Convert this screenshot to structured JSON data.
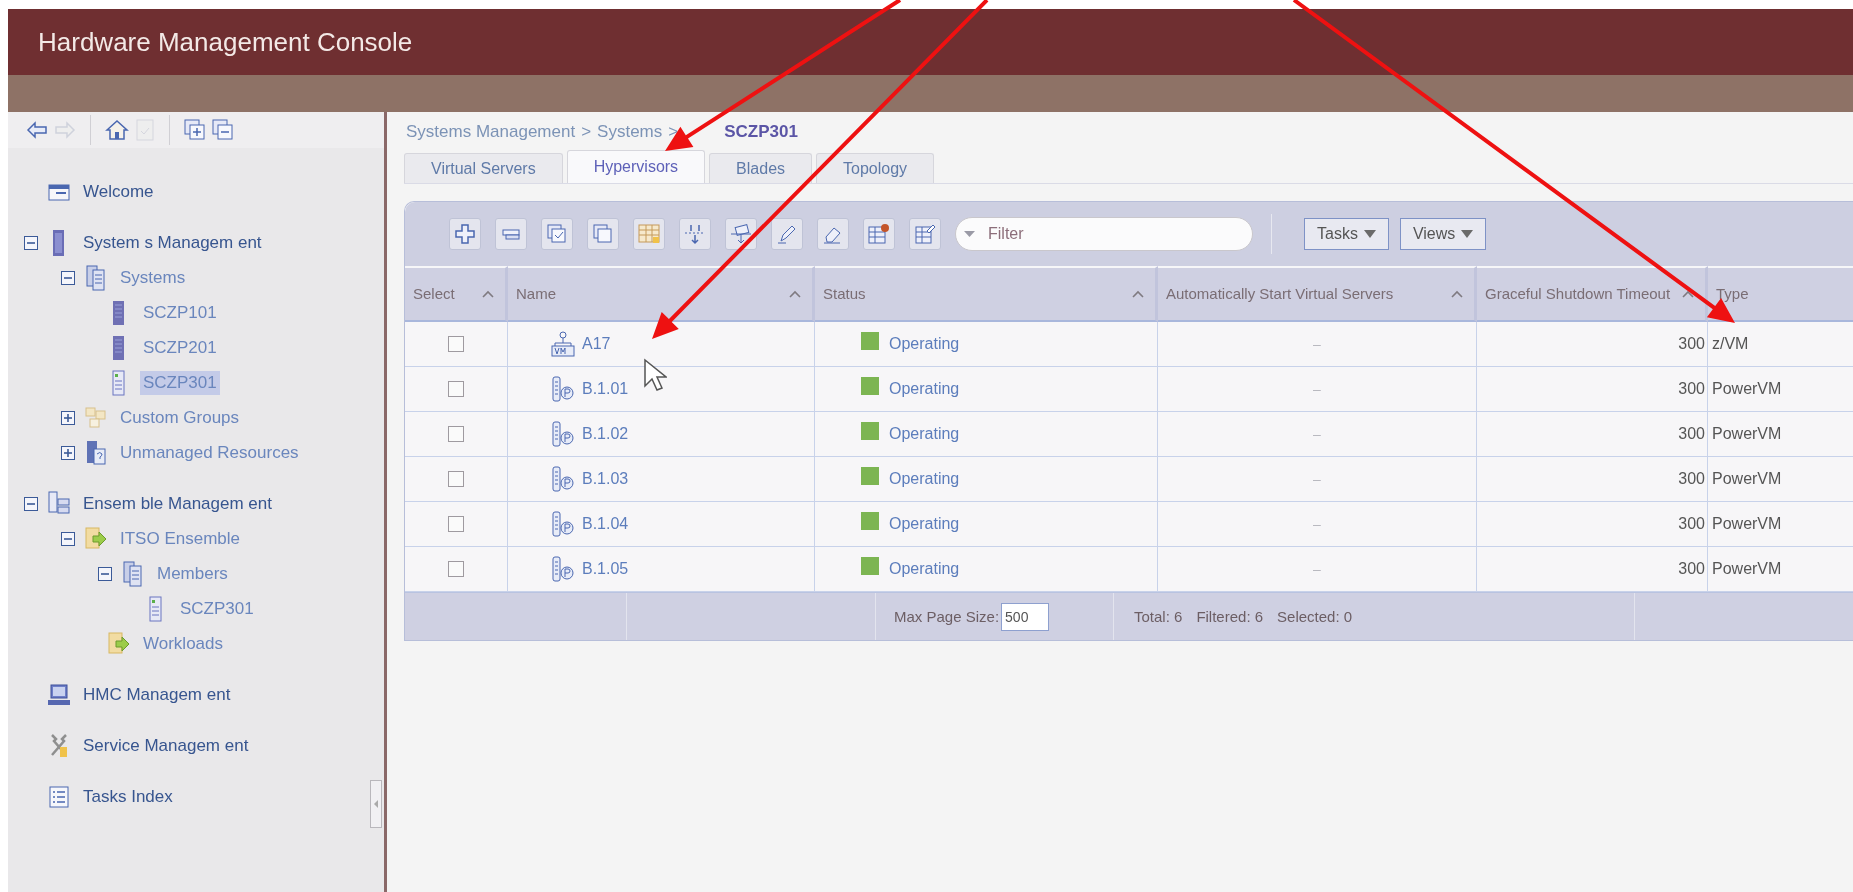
{
  "window": {
    "title": "Hardware Management Console"
  },
  "sidebar": {
    "items": [
      {
        "label": "Welcome",
        "kind": "page",
        "selected": false
      },
      {
        "label": "System s Managem ent",
        "kind": "rack",
        "selected": false,
        "expanded": true,
        "children": [
          {
            "label": "Systems",
            "kind": "servers",
            "selected": false,
            "expanded": true,
            "children": [
              {
                "label": "SCZP101",
                "kind": "server",
                "selected": false
              },
              {
                "label": "SCZP201",
                "kind": "server",
                "selected": false
              },
              {
                "label": "SCZP301",
                "kind": "server-green",
                "selected": true
              }
            ]
          },
          {
            "label": "Custom Groups",
            "kind": "group",
            "selected": false,
            "expanded": false
          },
          {
            "label": "Unmanaged Resources",
            "kind": "unmanaged",
            "selected": false,
            "expanded": false
          }
        ]
      },
      {
        "label": "Ensem ble Managem ent",
        "kind": "ensemble",
        "selected": false,
        "expanded": true,
        "children": [
          {
            "label": "ITSO Ensemble",
            "kind": "workload",
            "selected": false,
            "expanded": true,
            "children": [
              {
                "label": "Members",
                "kind": "servers",
                "selected": false,
                "expanded": true,
                "children": [
                  {
                    "label": "SCZP301",
                    "kind": "server-green",
                    "selected": false
                  }
                ]
              },
              {
                "label": "Workloads",
                "kind": "workload",
                "selected": false
              }
            ]
          }
        ]
      },
      {
        "label": "HMC Managem ent",
        "kind": "computer",
        "selected": false
      },
      {
        "label": "Service Managem ent",
        "kind": "tools",
        "selected": false
      },
      {
        "label": "Tasks Index",
        "kind": "list",
        "selected": false
      }
    ]
  },
  "breadcrumb": [
    {
      "kind": "link",
      "text": "Systems Management"
    },
    {
      "kind": "separator",
      "text": ">"
    },
    {
      "kind": "link",
      "text": "Systems"
    },
    {
      "kind": "separator",
      "text": ">"
    },
    {
      "kind": "current",
      "text": "SCZP301"
    }
  ],
  "tabs": [
    {
      "label": "Virtual Servers",
      "selected": false
    },
    {
      "label": "Hypervisors",
      "selected": true
    },
    {
      "label": "Blades",
      "selected": false
    },
    {
      "label": "Topology",
      "selected": false
    }
  ],
  "toolbar": {
    "filter": {
      "placeholder": "Filter"
    },
    "buttons": [
      "Tasks",
      "Views"
    ]
  },
  "table": {
    "columns": [
      {
        "label": "Select",
        "sortable": true
      },
      {
        "label": "Name",
        "sortable": true
      },
      {
        "label": "Status",
        "sortable": true
      },
      {
        "label": "Automatically Start Virtual Servers",
        "sortable": true
      },
      {
        "label": "Graceful Shutdown Timeout",
        "sortable": true
      },
      {
        "label": "Type",
        "sortable": false
      }
    ],
    "rows": [
      {
        "selected": false,
        "kind": "vm",
        "name": "A17",
        "status": "Operating",
        "color": "#7cb552",
        "auto_start": "–",
        "timeout": "300",
        "type": "z/VM"
      },
      {
        "selected": false,
        "kind": "blade",
        "name": "B.1.01",
        "status": "Operating",
        "color": "#7cb552",
        "auto_start": "–",
        "timeout": "300",
        "type": "PowerVM"
      },
      {
        "selected": false,
        "kind": "blade",
        "name": "B.1.02",
        "status": "Operating",
        "color": "#7cb552",
        "auto_start": "–",
        "timeout": "300",
        "type": "PowerVM"
      },
      {
        "selected": false,
        "kind": "blade",
        "name": "B.1.03",
        "status": "Operating",
        "color": "#7cb552",
        "auto_start": "–",
        "timeout": "300",
        "type": "PowerVM"
      },
      {
        "selected": false,
        "kind": "blade",
        "name": "B.1.04",
        "status": "Operating",
        "color": "#7cb552",
        "auto_start": "–",
        "timeout": "300",
        "type": "PowerVM"
      },
      {
        "selected": false,
        "kind": "blade",
        "name": "B.1.05",
        "status": "Operating",
        "color": "#7cb552",
        "auto_start": "–",
        "timeout": "300",
        "type": "PowerVM"
      }
    ]
  },
  "footer": {
    "page_size_label": "Max Page Size:",
    "page_size": "500",
    "total": "Total: 6",
    "filtered": "Filtered: 6",
    "selected": "Selected: 0"
  }
}
